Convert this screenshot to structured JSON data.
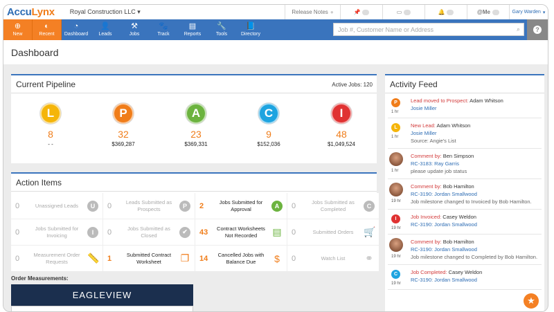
{
  "app": {
    "logo_a": "Accu",
    "logo_b": "Lynx",
    "company": "Royal Construction LLC",
    "release_notes": "Release Notes",
    "at_me": "@Me",
    "user": "Gary Warden"
  },
  "nav": {
    "new": "New",
    "recent": "Recent",
    "items": [
      "Dashboard",
      "Leads",
      "Jobs",
      "Track",
      "Reports",
      "Tools",
      "Directory"
    ],
    "search_placeholder": "Job #, Customer Name or Address"
  },
  "page": {
    "title": "Dashboard"
  },
  "pipeline": {
    "title": "Current Pipeline",
    "active_jobs": "Active Jobs: 120",
    "stages": [
      {
        "letter": "L",
        "count": "8",
        "amount": "- -",
        "color": "#f5b50a"
      },
      {
        "letter": "P",
        "count": "32",
        "amount": "$369,287",
        "color": "#f07d1a"
      },
      {
        "letter": "A",
        "count": "23",
        "amount": "$369,331",
        "color": "#6cb33f"
      },
      {
        "letter": "C",
        "count": "9",
        "amount": "$152,036",
        "color": "#1ea4e0"
      },
      {
        "letter": "I",
        "count": "48",
        "amount": "$1,049,524",
        "color": "#e03232"
      }
    ]
  },
  "actions": {
    "title": "Action Items",
    "items": [
      {
        "n": "0",
        "label": "Unassigned Leads",
        "icon": "U"
      },
      {
        "n": "0",
        "label": "Leads Submitted as Prospects",
        "icon": "P"
      },
      {
        "n": "2",
        "label": "Jobs Submitted for Approval",
        "icon": "A"
      },
      {
        "n": "0",
        "label": "Jobs Submitted as Completed",
        "icon": "C"
      },
      {
        "n": "0",
        "label": "Jobs Submitted for Invoicing",
        "icon": "I"
      },
      {
        "n": "0",
        "label": "Jobs Submitted as Closed",
        "icon": "✔"
      },
      {
        "n": "43",
        "label": "Contract Worksheets Not Recorded",
        "icon": "▤"
      },
      {
        "n": "0",
        "label": "Submitted Orders",
        "icon": "🛒"
      },
      {
        "n": "0",
        "label": "Measurement Order Requests",
        "icon": "📏"
      },
      {
        "n": "1",
        "label": "Submitted Contract Worksheet",
        "icon": "❐"
      },
      {
        "n": "14",
        "label": "Cancelled Jobs with Balance Due",
        "icon": "$"
      },
      {
        "n": "0",
        "label": "Watch List",
        "icon": "⚭"
      }
    ]
  },
  "order": {
    "label": "Order Measurements:",
    "brand": "EAGLEVIEW"
  },
  "feed": {
    "title": "Activity Feed",
    "items": [
      {
        "icon": "P",
        "color": "#f07d1a",
        "time": "1 hr",
        "action": "Lead moved to Prospect:",
        "who": "Adam Whitson",
        "link": "Josie Miller",
        "note": ""
      },
      {
        "icon": "L",
        "color": "#f5b50a",
        "time": "1 hr",
        "action": "New Lead:",
        "who": "Adam Whitson",
        "link": "Josie Miller",
        "note": "Source: Angie's List"
      },
      {
        "icon": "",
        "color": "",
        "time": "1 hr",
        "action": "Comment by:",
        "who": "Ben Simpson",
        "link": "RC-3183: Ray Garris",
        "note": "please update job status"
      },
      {
        "icon": "",
        "color": "",
        "time": "19 hr",
        "action": "Comment by:",
        "who": "Bob Hamilton",
        "link": "RC-3190: Jordan Smallwood",
        "note": "Job milestone changed to Invoiced by Bob Hamilton."
      },
      {
        "icon": "I",
        "color": "#e03232",
        "time": "19 hr",
        "action": "Job Invoiced:",
        "who": "Casey Weldon",
        "link": "RC-3190: Jordan Smallwood",
        "note": ""
      },
      {
        "icon": "",
        "color": "",
        "time": "19 hr",
        "action": "Comment by:",
        "who": "Bob Hamilton",
        "link": "RC-3190: Jordan Smallwood",
        "note": "Job milestone changed to Completed by Bob Hamilton."
      },
      {
        "icon": "C",
        "color": "#1ea4e0",
        "time": "19 hr",
        "action": "Job Completed:",
        "who": "Casey Weldon",
        "link": "RC-3190: Jordan Smallwood",
        "note": ""
      }
    ]
  }
}
